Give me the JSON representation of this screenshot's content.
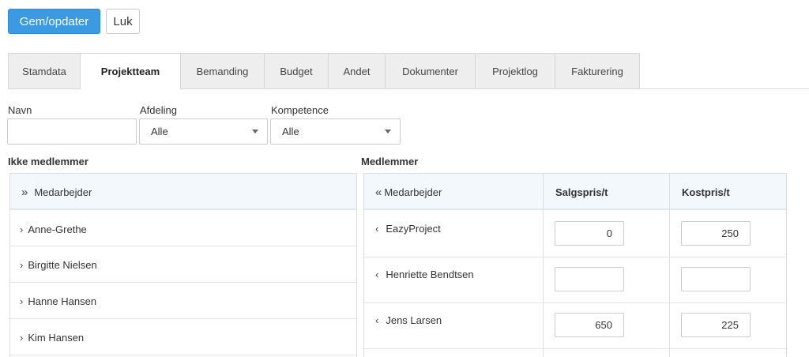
{
  "toolbar": {
    "save_label": "Gem/opdater",
    "close_label": "Luk"
  },
  "tabs": [
    {
      "label": "Stamdata"
    },
    {
      "label": "Projektteam",
      "active": true
    },
    {
      "label": "Bemanding"
    },
    {
      "label": "Budget"
    },
    {
      "label": "Andet"
    },
    {
      "label": "Dokumenter"
    },
    {
      "label": "Projektlog"
    },
    {
      "label": "Fakturering"
    }
  ],
  "filters": {
    "name_label": "Navn",
    "name_value": "",
    "department_label": "Afdeling",
    "department_value": "Alle",
    "competence_label": "Kompetence",
    "competence_value": "Alle"
  },
  "non_members": {
    "title": "Ikke medlemmer",
    "header_icon": "»",
    "header": "Medarbejder",
    "row_icon": "›",
    "rows": [
      "Anne-Grethe",
      "Birgitte Nielsen",
      "Hanne Hansen",
      "Kim Hansen"
    ]
  },
  "members": {
    "title": "Medlemmer",
    "header_icon": "«",
    "headers": {
      "employee": "Medarbejder",
      "sales": "Salgspris/t",
      "cost": "Kostpris/t"
    },
    "row_icon": "‹",
    "rows": [
      {
        "name": "EazyProject",
        "sales": "0",
        "cost": "250"
      },
      {
        "name": "Henriette Bendtsen",
        "sales": "",
        "cost": ""
      },
      {
        "name": "Jens Larsen",
        "sales": "650",
        "cost": "225"
      }
    ]
  },
  "colors": {
    "primary": "#3b9ae1",
    "tab_bg": "#eeeeee",
    "panel_head": "#f3f8fc"
  }
}
